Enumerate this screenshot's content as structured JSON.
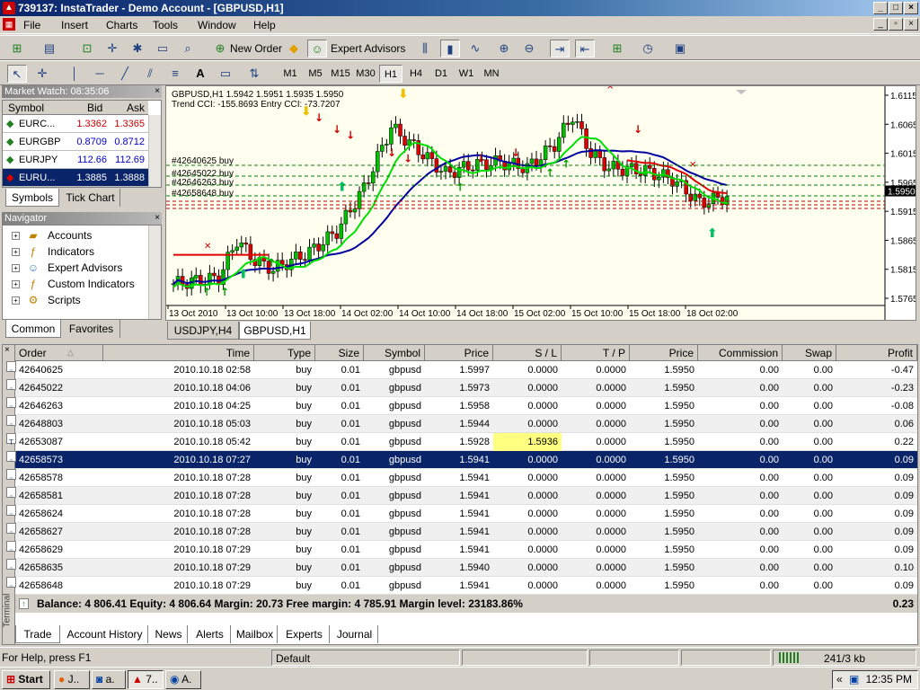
{
  "window": {
    "title": "739137: InstaTrader - Demo Account - [GBPUSD,H1]",
    "min": "_",
    "max": "□",
    "close": "×"
  },
  "menu": [
    "File",
    "Insert",
    "Charts",
    "Tools",
    "Window",
    "Help"
  ],
  "toolbar": {
    "new_order": "New Order",
    "expert_advisors": "Expert Advisors"
  },
  "timeframes": [
    "M1",
    "M5",
    "M15",
    "M30",
    "H1",
    "H4",
    "D1",
    "W1",
    "MN"
  ],
  "market_watch": {
    "title": "Market Watch: 08:35:06",
    "columns": [
      "Symbol",
      "Bid",
      "Ask"
    ],
    "rows": [
      {
        "symbol": "EURC...",
        "bid": "1.3362",
        "ask": "1.3365",
        "dir": "up",
        "color": "#cc0000"
      },
      {
        "symbol": "EURGBP",
        "bid": "0.8709",
        "ask": "0.8712",
        "dir": "up",
        "color": "#0000cc"
      },
      {
        "symbol": "EURJPY",
        "bid": "112.66",
        "ask": "112.69",
        "dir": "up",
        "color": "#0000cc"
      },
      {
        "symbol": "EURU...",
        "bid": "1.3885",
        "ask": "1.3888",
        "dir": "down",
        "color": "#ffffff"
      }
    ],
    "tabs": [
      "Symbols",
      "Tick Chart"
    ]
  },
  "navigator": {
    "title": "Navigator",
    "items": [
      "Accounts",
      "Indicators",
      "Expert Advisors",
      "Custom Indicators",
      "Scripts"
    ],
    "tabs": [
      "Common",
      "Favorites"
    ]
  },
  "chart": {
    "header": "GBPUSD,H1  1.5942 1.5951 1.5935 1.5950",
    "indicator": "Trend CCI: -155.8693 Entry CCI: -73.7207",
    "order_labels": [
      "#42640625 buy",
      "#42645022 buy",
      "#42646263 buy",
      "#42658648 buy"
    ],
    "price_ticks": [
      "1.6115",
      "1.6065",
      "1.6015",
      "1.5965",
      "1.5915",
      "1.5865",
      "1.5815",
      "1.5765"
    ],
    "current_price": "1.5950",
    "time_ticks": [
      "13 Oct 2010",
      "13 Oct 10:00",
      "13 Oct 18:00",
      "14 Oct 02:00",
      "14 Oct 10:00",
      "14 Oct 18:00",
      "15 Oct 02:00",
      "15 Oct 10:00",
      "15 Oct 18:00",
      "18 Oct 02:00"
    ],
    "tabs": [
      "USDJPY,H4",
      "GBPUSD,H1"
    ],
    "colors": {
      "bull": "#00c000",
      "bear": "#e00000",
      "fast_ma": "#00e000",
      "slow_ma": "#0000a0",
      "bg": "#fffff0"
    }
  },
  "terminal": {
    "side_label": "Terminal",
    "columns": [
      "Order",
      "Time",
      "Type",
      "Size",
      "Symbol",
      "Price",
      "S / L",
      "T / P",
      "Price",
      "Commission",
      "Swap",
      "Profit"
    ],
    "rows": [
      [
        "42640625",
        "2010.10.18 02:58",
        "buy",
        "0.01",
        "gbpusd",
        "1.5997",
        "0.0000",
        "0.0000",
        "1.5950",
        "0.00",
        "0.00",
        "-0.47"
      ],
      [
        "42645022",
        "2010.10.18 04:06",
        "buy",
        "0.01",
        "gbpusd",
        "1.5973",
        "0.0000",
        "0.0000",
        "1.5950",
        "0.00",
        "0.00",
        "-0.23"
      ],
      [
        "42646263",
        "2010.10.18 04:25",
        "buy",
        "0.01",
        "gbpusd",
        "1.5958",
        "0.0000",
        "0.0000",
        "1.5950",
        "0.00",
        "0.00",
        "-0.08"
      ],
      [
        "42648803",
        "2010.10.18 05:03",
        "buy",
        "0.01",
        "gbpusd",
        "1.5944",
        "0.0000",
        "0.0000",
        "1.5950",
        "0.00",
        "0.00",
        "0.06"
      ],
      [
        "42653087",
        "2010.10.18 05:42",
        "buy",
        "0.01",
        "gbpusd",
        "1.5928",
        "1.5936",
        "0.0000",
        "1.5950",
        "0.00",
        "0.00",
        "0.22"
      ],
      [
        "42658573",
        "2010.10.18 07:27",
        "buy",
        "0.01",
        "gbpusd",
        "1.5941",
        "0.0000",
        "0.0000",
        "1.5950",
        "0.00",
        "0.00",
        "0.09"
      ],
      [
        "42658578",
        "2010.10.18 07:28",
        "buy",
        "0.01",
        "gbpusd",
        "1.5941",
        "0.0000",
        "0.0000",
        "1.5950",
        "0.00",
        "0.00",
        "0.09"
      ],
      [
        "42658581",
        "2010.10.18 07:28",
        "buy",
        "0.01",
        "gbpusd",
        "1.5941",
        "0.0000",
        "0.0000",
        "1.5950",
        "0.00",
        "0.00",
        "0.09"
      ],
      [
        "42658624",
        "2010.10.18 07:28",
        "buy",
        "0.01",
        "gbpusd",
        "1.5941",
        "0.0000",
        "0.0000",
        "1.5950",
        "0.00",
        "0.00",
        "0.09"
      ],
      [
        "42658627",
        "2010.10.18 07:28",
        "buy",
        "0.01",
        "gbpusd",
        "1.5941",
        "0.0000",
        "0.0000",
        "1.5950",
        "0.00",
        "0.00",
        "0.09"
      ],
      [
        "42658629",
        "2010.10.18 07:29",
        "buy",
        "0.01",
        "gbpusd",
        "1.5941",
        "0.0000",
        "0.0000",
        "1.5950",
        "0.00",
        "0.00",
        "0.09"
      ],
      [
        "42658635",
        "2010.10.18 07:29",
        "buy",
        "0.01",
        "gbpusd",
        "1.5940",
        "0.0000",
        "0.0000",
        "1.5950",
        "0.00",
        "0.00",
        "0.10"
      ],
      [
        "42658648",
        "2010.10.18 07:29",
        "buy",
        "0.01",
        "gbpusd",
        "1.5941",
        "0.0000",
        "0.0000",
        "1.5950",
        "0.00",
        "0.00",
        "0.09"
      ]
    ],
    "selected_row": 5,
    "highlight_sl_row": 4,
    "balance_line": "Balance: 4 806.41  Equity: 4 806.64  Margin: 20.73  Free margin: 4 785.91  Margin level: 23183.86%",
    "total_profit": "0.23",
    "tabs": [
      "Trade",
      "Account History",
      "News",
      "Alerts",
      "Mailbox",
      "Experts",
      "Journal"
    ]
  },
  "statusbar": {
    "help": "For Help, press F1",
    "profile": "Default",
    "traffic": "241/3 kb"
  },
  "taskbar": {
    "start": "Start",
    "items": [
      "J..",
      "a.",
      "7..",
      "A."
    ],
    "clock": "12:35 PM"
  }
}
